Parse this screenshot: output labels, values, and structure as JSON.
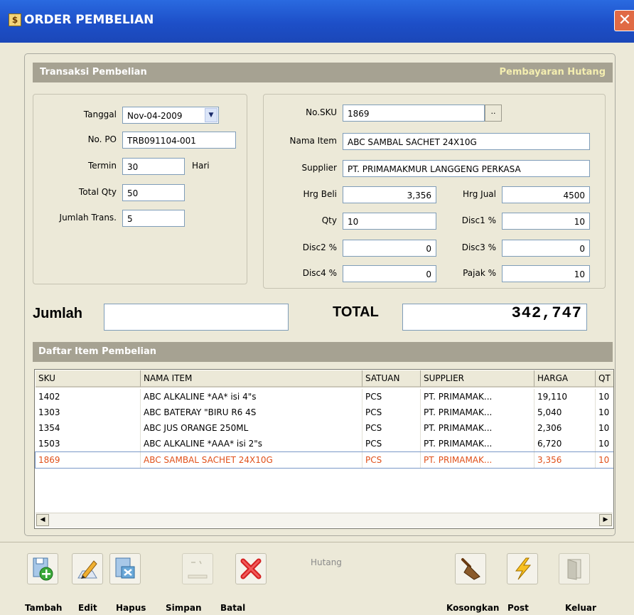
{
  "window": {
    "title": "ORDER PEMBELIAN",
    "icon": "app-icon",
    "close_glyph": "✕"
  },
  "header": {
    "left": "Transaksi Pembelian",
    "right": "Pembayaran Hutang"
  },
  "left_form": {
    "tanggal_label": "Tanggal",
    "tanggal_value": "Nov-04-2009",
    "nopo_label": "No. PO",
    "nopo_value": "TRB091104-001",
    "termin_label": "Termin",
    "termin_value": "30",
    "termin_unit": "Hari",
    "totalqty_label": "Total Qty",
    "totalqty_value": "50",
    "jumlahtrans_label": "Jumlah Trans.",
    "jumlahtrans_value": "5"
  },
  "right_form": {
    "sku_label": "No.SKU",
    "sku_value": "1869",
    "sku_browse": "..",
    "nama_label": "Nama Item",
    "nama_value": "ABC SAMBAL SACHET 24X10G",
    "supplier_label": "Supplier",
    "supplier_value": "PT. PRIMAMAKMUR LANGGENG PERKASA",
    "hrgbeli_label": "Hrg Beli",
    "hrgbeli_value": "3,356",
    "hrgjual_label": "Hrg Jual",
    "hrgjual_value": "4500",
    "qty_label": "Qty",
    "qty_value": "10",
    "disc1_label": "Disc1 %",
    "disc1_value": "10",
    "disc2_label": "Disc2 %",
    "disc2_value": "0",
    "disc3_label": "Disc3 %",
    "disc3_value": "0",
    "disc4_label": "Disc4 %",
    "disc4_value": "0",
    "pajak_label": "Pajak %",
    "pajak_value": "10"
  },
  "totals": {
    "jumlah_label": "Jumlah",
    "jumlah_value": "",
    "total_label": "TOTAL",
    "total_value": "342,747"
  },
  "items_section": {
    "title": "Daftar Item Pembelian"
  },
  "grid": {
    "columns": [
      "SKU",
      "NAMA ITEM",
      "SATUAN",
      "SUPPLIER",
      "HARGA",
      "QT"
    ],
    "rows": [
      [
        "1402",
        "ABC ALKALINE *AA* isi 4\"s",
        "PCS",
        "PT. PRIMAMAK...",
        "19,110",
        "10"
      ],
      [
        "1303",
        "ABC BATERAY \"BIRU R6 4S",
        "PCS",
        "PT. PRIMAMAK...",
        "5,040",
        "10"
      ],
      [
        "1354",
        "ABC JUS ORANGE 250ML",
        "PCS",
        "PT. PRIMAMAK...",
        "2,306",
        "10"
      ],
      [
        "1503",
        "ABC ALKALINE *AAA* isi 2\"s",
        "PCS",
        "PT. PRIMAMAK...",
        "6,720",
        "10"
      ],
      [
        "1869",
        "ABC SAMBAL SACHET 24X10G",
        "PCS",
        "PT. PRIMAMAK...",
        "3,356",
        "10"
      ]
    ],
    "selected_row": 4,
    "selected_color": "#e0501a"
  },
  "toolbar": {
    "tambah": "Tambah",
    "edit": "Edit",
    "hapus": "Hapus",
    "simpan": "Simpan",
    "batal": "Batal",
    "hutang": "Hutang",
    "kosongkan": "Kosongkan",
    "post": "Post",
    "keluar": "Keluar"
  }
}
